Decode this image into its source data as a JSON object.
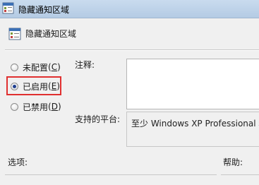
{
  "window": {
    "title": "隐藏通知区域",
    "icon": "policy-settings-icon"
  },
  "header": {
    "title": "隐藏通知区域",
    "icon": "policy-settings-icon"
  },
  "state": {
    "options": [
      {
        "label": "未配置",
        "accel": "C",
        "checked": false
      },
      {
        "label": "已启用",
        "accel": "E",
        "checked": true
      },
      {
        "label": "已禁用",
        "accel": "D",
        "checked": false
      }
    ],
    "highlight_color": "#e03030"
  },
  "comment": {
    "label": "注释:",
    "value": ""
  },
  "platform": {
    "label": "支持的平台:",
    "value": "至少 Windows XP Professional 和"
  },
  "sections": {
    "options_label": "选项:",
    "help_label": "帮助:"
  }
}
